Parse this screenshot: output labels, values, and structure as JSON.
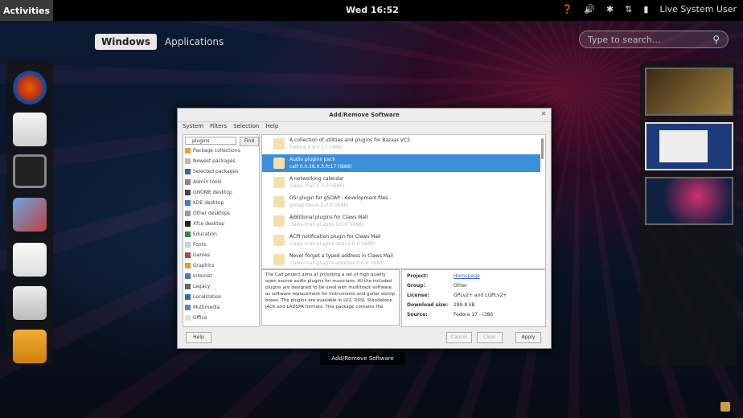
{
  "topbar": {
    "activities": "Activities",
    "clock": "Wed 16:52",
    "user": "Live System User",
    "tray_icons": [
      "help-icon",
      "volume-icon",
      "bluetooth-icon",
      "network-icon",
      "battery-icon"
    ]
  },
  "overview": {
    "tab_windows": "Windows",
    "tab_applications": "Applications",
    "search_placeholder": "Type to search..."
  },
  "dash": {
    "icons": [
      "firefox-icon",
      "mail-clock-icon",
      "camera-app-icon",
      "photos-icon",
      "document-icon",
      "download-installer-icon",
      "files-icon"
    ]
  },
  "window": {
    "title": "Add/Remove Software",
    "label": "Add/Remove Software",
    "menu": [
      "System",
      "Filters",
      "Selection",
      "Help"
    ],
    "search_value": "plugins",
    "find_label": "Find",
    "groups": [
      "Package collections",
      "Newest packages",
      "Selected packages",
      "Admin tools",
      "GNOME desktop",
      "KDE desktop",
      "Other desktops",
      "Xfce desktop",
      "Education",
      "Fonts",
      "Games",
      "Graphics",
      "Internet",
      "Legacy",
      "Localization",
      "Multimedia",
      "Office"
    ],
    "packages": [
      {
        "name": "A collection of utilities and plugins for Bazaar VCS",
        "sub": "Fedora 0.6.0.17 (i686)"
      },
      {
        "name": "Audio plugins pack",
        "sub": "calf 0.0.18.6.5.fc17 (i686)"
      },
      {
        "name": "A networking calendar",
        "sub": "claws-mail 0.0.0 (i686)"
      },
      {
        "name": "GSI plugin for gSOAP - development files",
        "sub": "gsoap-devel 0.0.0 (i686)"
      },
      {
        "name": "Additional plugins for Claws Mail",
        "sub": "claws-mail-plugins 0.0.0 (i686)"
      },
      {
        "name": "ACPI notification plugin for Claws Mail",
        "sub": "claws-mail-plugins-acpi 0.0.0 (i686)"
      },
      {
        "name": "Never forget a typed address in Claws Mail",
        "sub": "claws-mail-plugins-address 0.0.0 (i686)"
      }
    ],
    "description": "The Calf project aims at providing a set of high quality open source audio plugins for musicians. All the included plugins are designed to be used with multitrack software, as software replacement for instruments and guitar stomp boxes. The plugins are available in LV2, DSSI, Standalone JACK and LADSPA formats. This package contains the",
    "details": [
      {
        "key": "Project:",
        "value": "Homepage"
      },
      {
        "key": "Group:",
        "value": "Other"
      },
      {
        "key": "License:",
        "value": "GPLv2+ and LGPLv2+"
      },
      {
        "key": "Download size:",
        "value": "289.8 kB"
      },
      {
        "key": "Source:",
        "value": "Fedora 17 - i386"
      }
    ],
    "buttons": {
      "help": "Help",
      "cancel": "Cancel",
      "clear": "Clear",
      "apply": "Apply"
    }
  },
  "colors": {
    "accent": "#3c8ed8",
    "topbar": "#000000",
    "window_bg": "#ededed"
  }
}
